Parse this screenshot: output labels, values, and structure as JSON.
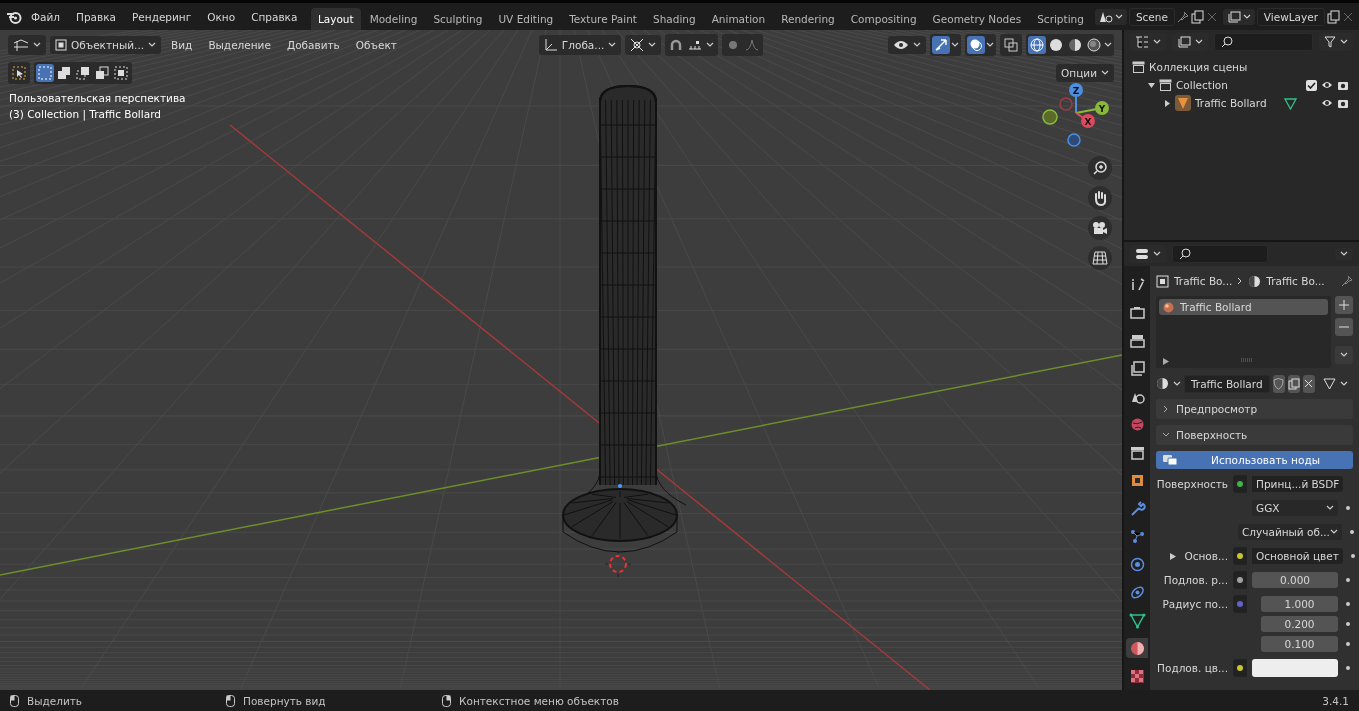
{
  "menu": [
    "Файл",
    "Правка",
    "Рендеринг",
    "Окно",
    "Справка"
  ],
  "workspaces": [
    {
      "label": "Layout",
      "selected": true
    },
    {
      "label": "Modeling",
      "selected": false
    },
    {
      "label": "Sculpting",
      "selected": false
    },
    {
      "label": "UV Editing",
      "selected": false
    },
    {
      "label": "Texture Paint",
      "selected": false
    },
    {
      "label": "Shading",
      "selected": false
    },
    {
      "label": "Animation",
      "selected": false
    },
    {
      "label": "Rendering",
      "selected": false
    },
    {
      "label": "Compositing",
      "selected": false
    },
    {
      "label": "Geometry Nodes",
      "selected": false
    },
    {
      "label": "Scripting",
      "selected": false
    }
  ],
  "scene": {
    "name": "Scene"
  },
  "view_layer": {
    "name": "ViewLayer"
  },
  "viewport": {
    "mode": "Объектный...",
    "menus": [
      "Вид",
      "Выделение",
      "Добавить",
      "Объект"
    ],
    "orientation": "Глоба...",
    "options": "Опции",
    "view_name": "Пользовательская перспектива",
    "object_info": "(3) Collection | Traffic Bollard",
    "gizmo_axes": [
      "Z",
      "Y",
      "X"
    ],
    "shading_modes": [
      {
        "selected": true
      },
      {
        "selected": false
      },
      {
        "selected": false
      },
      {
        "selected": false
      }
    ]
  },
  "outliner": {
    "root": "Коллекция сцены",
    "children": [
      {
        "label": "Collection",
        "expanded": true,
        "checked": true,
        "children": [
          {
            "label": "Traffic Bollard",
            "expanded": false
          }
        ]
      }
    ]
  },
  "properties": {
    "breadcrumb": [
      "Traffic Bo...",
      "Traffic Bo..."
    ],
    "tabs": [
      {
        "kind": "tool",
        "selected": false
      },
      {
        "kind": "render",
        "selected": false
      },
      {
        "kind": "output",
        "selected": false
      },
      {
        "kind": "view_layer",
        "selected": false
      },
      {
        "kind": "scene",
        "selected": false
      },
      {
        "kind": "world",
        "selected": false
      },
      {
        "kind": "collection",
        "selected": false
      },
      {
        "kind": "object",
        "selected": false
      },
      {
        "kind": "modifier",
        "selected": false
      },
      {
        "kind": "particles",
        "selected": false
      },
      {
        "kind": "physics",
        "selected": false
      },
      {
        "kind": "constraints",
        "selected": false
      },
      {
        "kind": "data",
        "selected": false
      },
      {
        "kind": "material",
        "selected": true
      },
      {
        "kind": "texture",
        "selected": false
      }
    ],
    "material_slots": [
      {
        "name": "Traffic Bollard",
        "selected": true
      }
    ],
    "material_name": "Traffic Bollard",
    "panels": [
      {
        "title": "Предпросмотр",
        "expanded": false
      },
      {
        "title": "Поверхность",
        "expanded": true
      }
    ],
    "use_nodes": "Использовать ноды",
    "rows": [
      {
        "kind": "socket",
        "label": "Поверхность",
        "value": "Принц...й BSDF",
        "color": "#3fb24a"
      },
      {
        "kind": "dropdown",
        "value": "GGX"
      },
      {
        "kind": "dropdown",
        "value": "Случайный об..."
      },
      {
        "kind": "socket",
        "label": "Основ...",
        "value": "Основной цвет",
        "color": "#c7c729",
        "expandable": true
      },
      {
        "kind": "number",
        "label": "Подлов. р...",
        "value": "0.000",
        "color": "#a1a1a1"
      },
      {
        "kind": "vector",
        "label": "Радиус по...",
        "values": [
          "1.000",
          "0.200",
          "0.100"
        ],
        "color": "#6363c7"
      },
      {
        "kind": "swatch",
        "label": "Подлов. цв...",
        "color": "#c7c729"
      }
    ]
  },
  "status_bar": {
    "items": [
      "Выделить",
      "Повернуть вид",
      "Контекстное меню объектов"
    ],
    "version": "3.4.1"
  }
}
